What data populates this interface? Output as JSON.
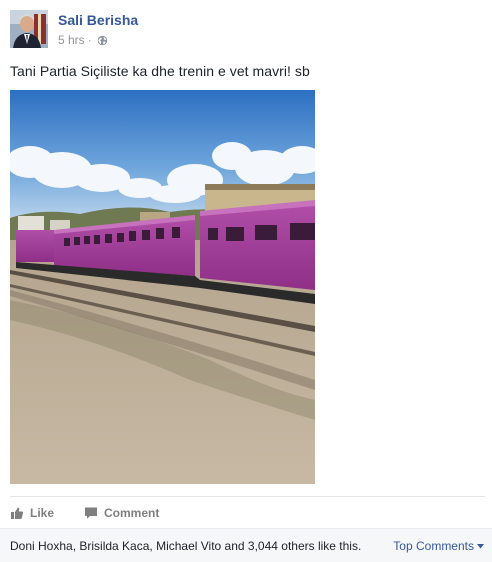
{
  "post": {
    "author": "Sali Berisha",
    "time": "5 hrs",
    "separator": "·",
    "privacy_icon": "globe-icon",
    "text": "Tani Partia Siçiliste ka dhe trenin e vet mavri! sb"
  },
  "actions": {
    "like_label": "Like",
    "comment_label": "Comment"
  },
  "footer": {
    "likes_summary": "Doni Hoxha, Brisilda Kaca, Michael Vito and 3,044 others like this.",
    "top_comments_label": "Top Comments"
  },
  "colors": {
    "link": "#365899",
    "muted": "#90949c",
    "train": "#a43f9c"
  }
}
